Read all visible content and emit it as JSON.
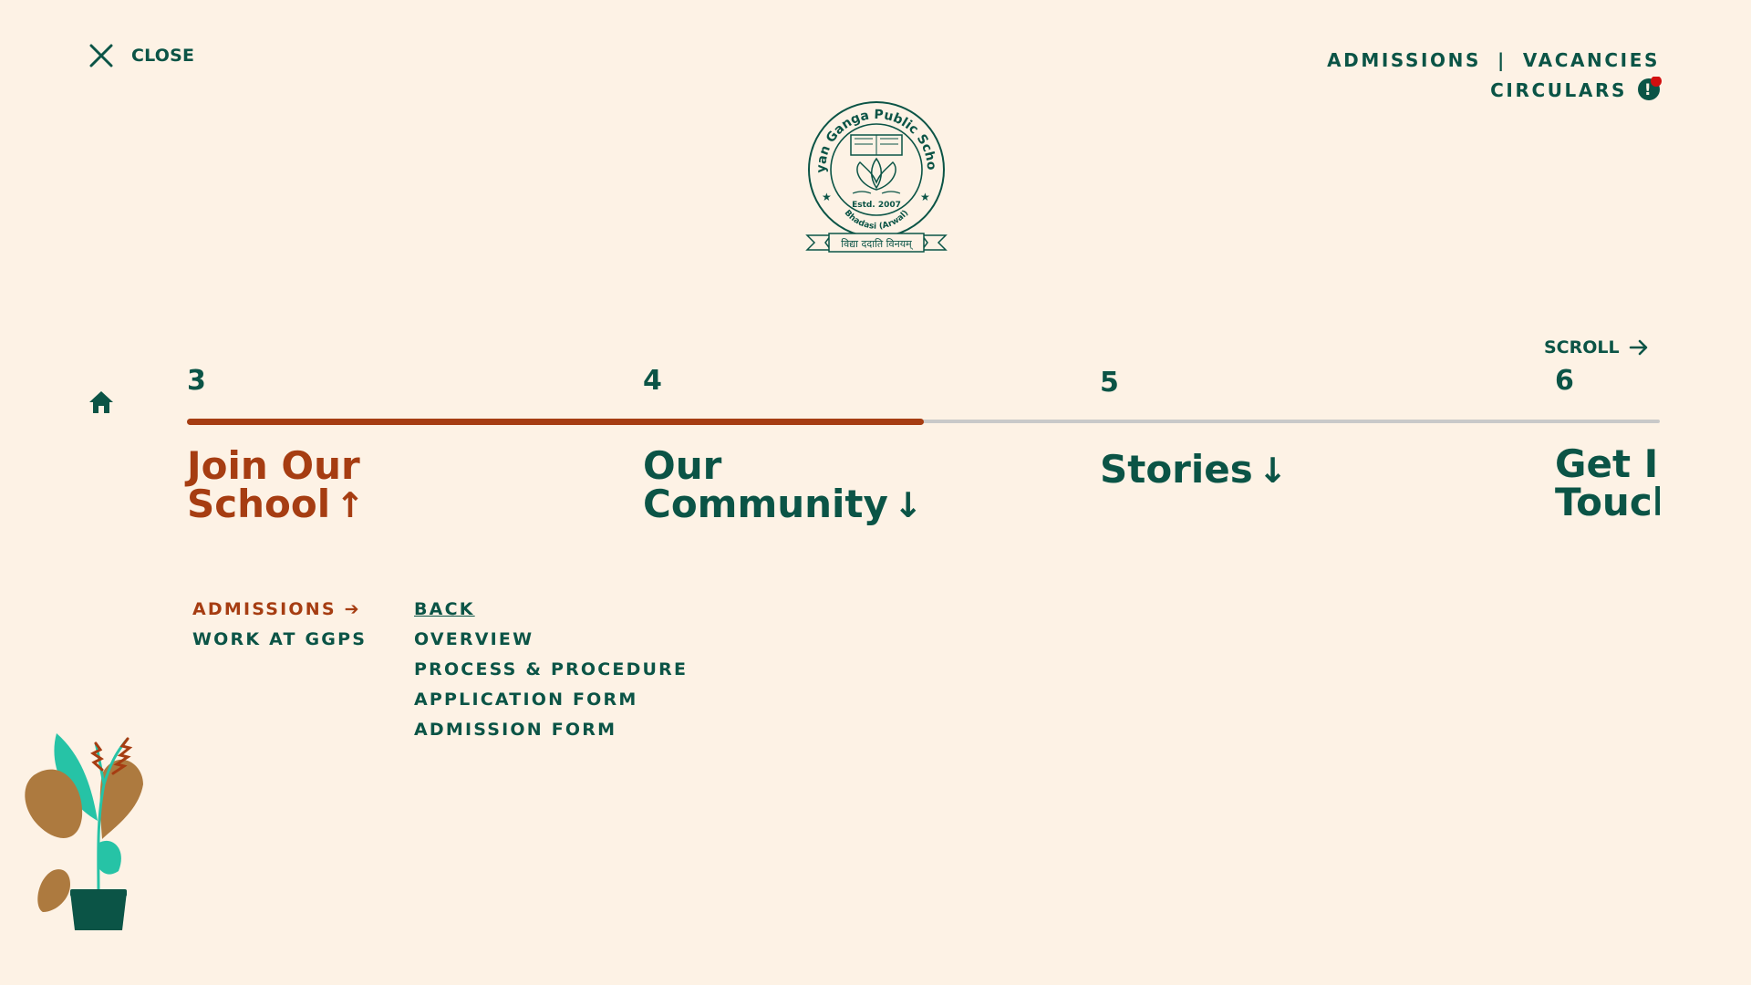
{
  "header": {
    "close_label": "CLOSE",
    "links": {
      "admissions": "ADMISSIONS",
      "separator": "|",
      "vacancies": "VACANCIES",
      "circulars": "CIRCULARS"
    },
    "alert_badge": "!"
  },
  "logo": {
    "school_name": "Gyan Ganga Public School",
    "established": "Estd. 2007",
    "location": "Bhadasi (Arwal)",
    "motto": "विद्या ददाति विनयम्"
  },
  "scroll_label": "SCROLL",
  "progress": {
    "fraction": 0.5
  },
  "sections": [
    {
      "number": "3",
      "title_line1": "Join Our",
      "title_line2": "School",
      "arrow": "↑"
    },
    {
      "number": "4",
      "title_line1": "Our",
      "title_line2": "Community",
      "arrow": "↓"
    },
    {
      "number": "5",
      "title_line1": "Stories",
      "arrow": "↓"
    },
    {
      "number": "6",
      "title_line1": "Get In",
      "title_line2": "Touch"
    }
  ],
  "submenu_left": {
    "admissions": "ADMISSIONS",
    "admissions_arrow": "➔",
    "work": "WORK AT GGPS"
  },
  "submenu_right": [
    "BACK",
    "OVERVIEW",
    "PROCESS & PROCEDURE",
    "APPLICATION FORM",
    "ADMISSION FORM"
  ],
  "colors": {
    "primary": "#0b5446",
    "accent": "#a63d12",
    "background": "#fdf2e5",
    "badge": "#d20f0f"
  },
  "icons": [
    "close-icon",
    "home-icon",
    "arrow-right-icon",
    "alert-icon",
    "plant-illustration"
  ]
}
